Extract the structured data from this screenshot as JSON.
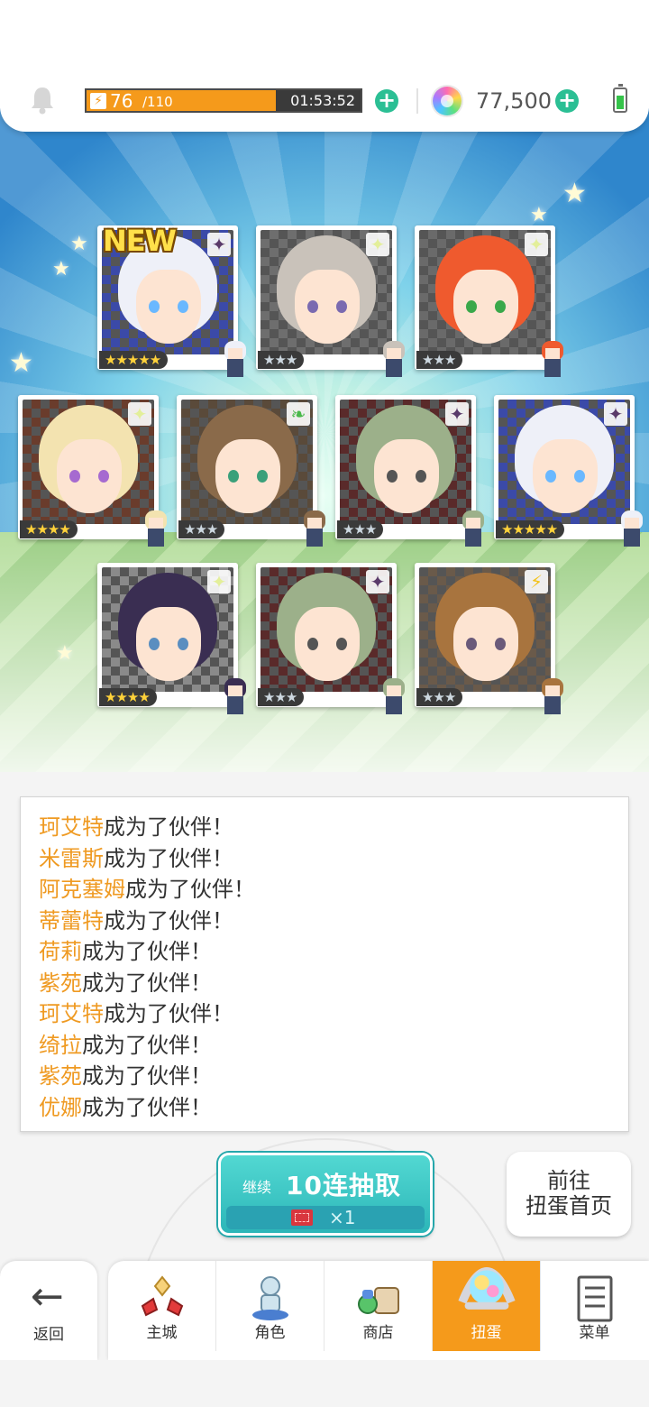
{
  "status_bar": {
    "stamina_current": "76",
    "stamina_max": "/110",
    "stamina_fraction": 0.69,
    "stamina_timer": "01:53:52",
    "gem_count": "77,500"
  },
  "results": {
    "new_badge": "NEW",
    "cards": [
      {
        "element": "dark",
        "stars": "★★★★★",
        "rarity": 5,
        "is_new": true
      },
      {
        "element": "light",
        "stars": "★★★",
        "rarity": 3,
        "is_new": false
      },
      {
        "element": "light",
        "stars": "★★★",
        "rarity": 3,
        "is_new": false
      },
      {
        "element": "light",
        "stars": "★★★★",
        "rarity": 4,
        "is_new": false
      },
      {
        "element": "wind",
        "stars": "★★★",
        "rarity": 3,
        "is_new": false
      },
      {
        "element": "dark",
        "stars": "★★★",
        "rarity": 3,
        "is_new": false
      },
      {
        "element": "dark",
        "stars": "★★★★★",
        "rarity": 5,
        "is_new": false
      },
      {
        "element": "light",
        "stars": "★★★★",
        "rarity": 4,
        "is_new": false
      },
      {
        "element": "dark",
        "stars": "★★★",
        "rarity": 3,
        "is_new": false
      },
      {
        "element": "thunder",
        "stars": "★★★",
        "rarity": 3,
        "is_new": false
      }
    ]
  },
  "log": {
    "suffix": "成为了伙伴！",
    "names": [
      "珂艾特",
      "米雷斯",
      "阿克塞姆",
      "蒂蕾特",
      "荷莉",
      "紫苑",
      "珂艾特",
      "绮拉",
      "紫苑",
      "优娜"
    ]
  },
  "actions": {
    "continue_small": "继续",
    "continue_main": "10连抽取",
    "continue_cost": "×1",
    "gacha_home_line1": "前往",
    "gacha_home_line2": "扭蛋首页"
  },
  "nav": {
    "back": "返回",
    "tabs": [
      "主城",
      "角色",
      "商店",
      "扭蛋",
      "菜单"
    ],
    "active_tab": "扭蛋"
  },
  "colors": {
    "accent_orange": "#f59a1b",
    "name_orange": "#ef9a22",
    "teal_button": "#2cb6b8",
    "plus_green": "#2bbf94"
  }
}
